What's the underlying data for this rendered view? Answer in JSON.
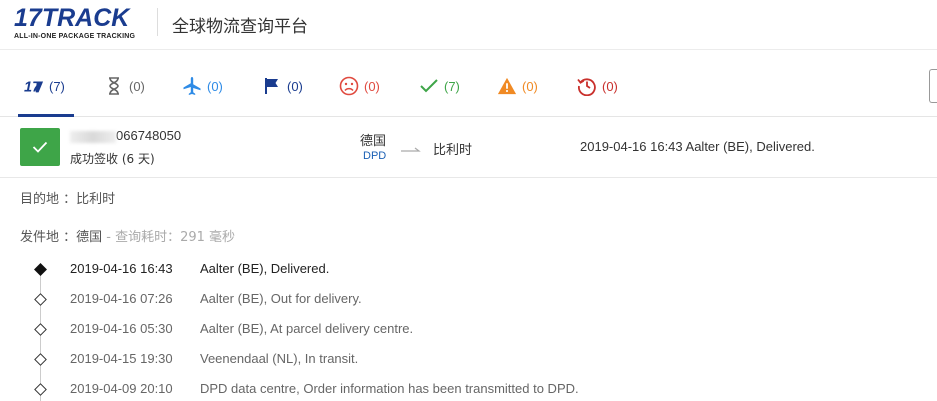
{
  "header": {
    "logo_text_num": "17",
    "logo_text_word": "TRACK",
    "logo_tagline": "ALL-IN-ONE PACKAGE TRACKING",
    "site_title": "全球物流查询平台"
  },
  "tabs": [
    {
      "icon": "17track-all-icon",
      "count": "(7)",
      "color": "#1a3c8f",
      "active": true
    },
    {
      "icon": "hourglass-icon",
      "count": "(0)",
      "color": "#666666"
    },
    {
      "icon": "airplane-icon",
      "count": "(0)",
      "color": "#2e8be6"
    },
    {
      "icon": "flag-icon",
      "count": "(0)",
      "color": "#1a3c8f"
    },
    {
      "icon": "sad-face-icon",
      "count": "(0)",
      "color": "#e04a3f"
    },
    {
      "icon": "checkmark-icon",
      "count": "(7)",
      "color": "#3ea548"
    },
    {
      "icon": "warning-icon",
      "count": "(0)",
      "color": "#f08a24"
    },
    {
      "icon": "expired-clock-icon",
      "count": "(0)",
      "color": "#c9302c"
    }
  ],
  "result": {
    "tracking_number_visible": "066748050",
    "status_text": "成功签收 (6 天)",
    "origin_country": "德国",
    "carrier": "DPD",
    "destination_country": "比利时",
    "last_event": "2019-04-16 16:43  Aalter (BE), Delivered.",
    "status_color": "#3ea548"
  },
  "details": {
    "destination_label": "目的地 ：比利时",
    "origin_label": "发件地 ：德国",
    "query_time": " - 查询耗时：291 毫秒"
  },
  "events": [
    {
      "time": "2019-04-16 16:43",
      "desc": "Aalter (BE), Delivered."
    },
    {
      "time": "2019-04-16 07:26",
      "desc": "Aalter (BE), Out for delivery."
    },
    {
      "time": "2019-04-16 05:30",
      "desc": "Aalter (BE), At parcel delivery centre."
    },
    {
      "time": "2019-04-15 19:30",
      "desc": "Veenendaal (NL), In transit."
    },
    {
      "time": "2019-04-09 20:10",
      "desc": "DPD data centre, Order information has been transmitted to DPD."
    }
  ]
}
